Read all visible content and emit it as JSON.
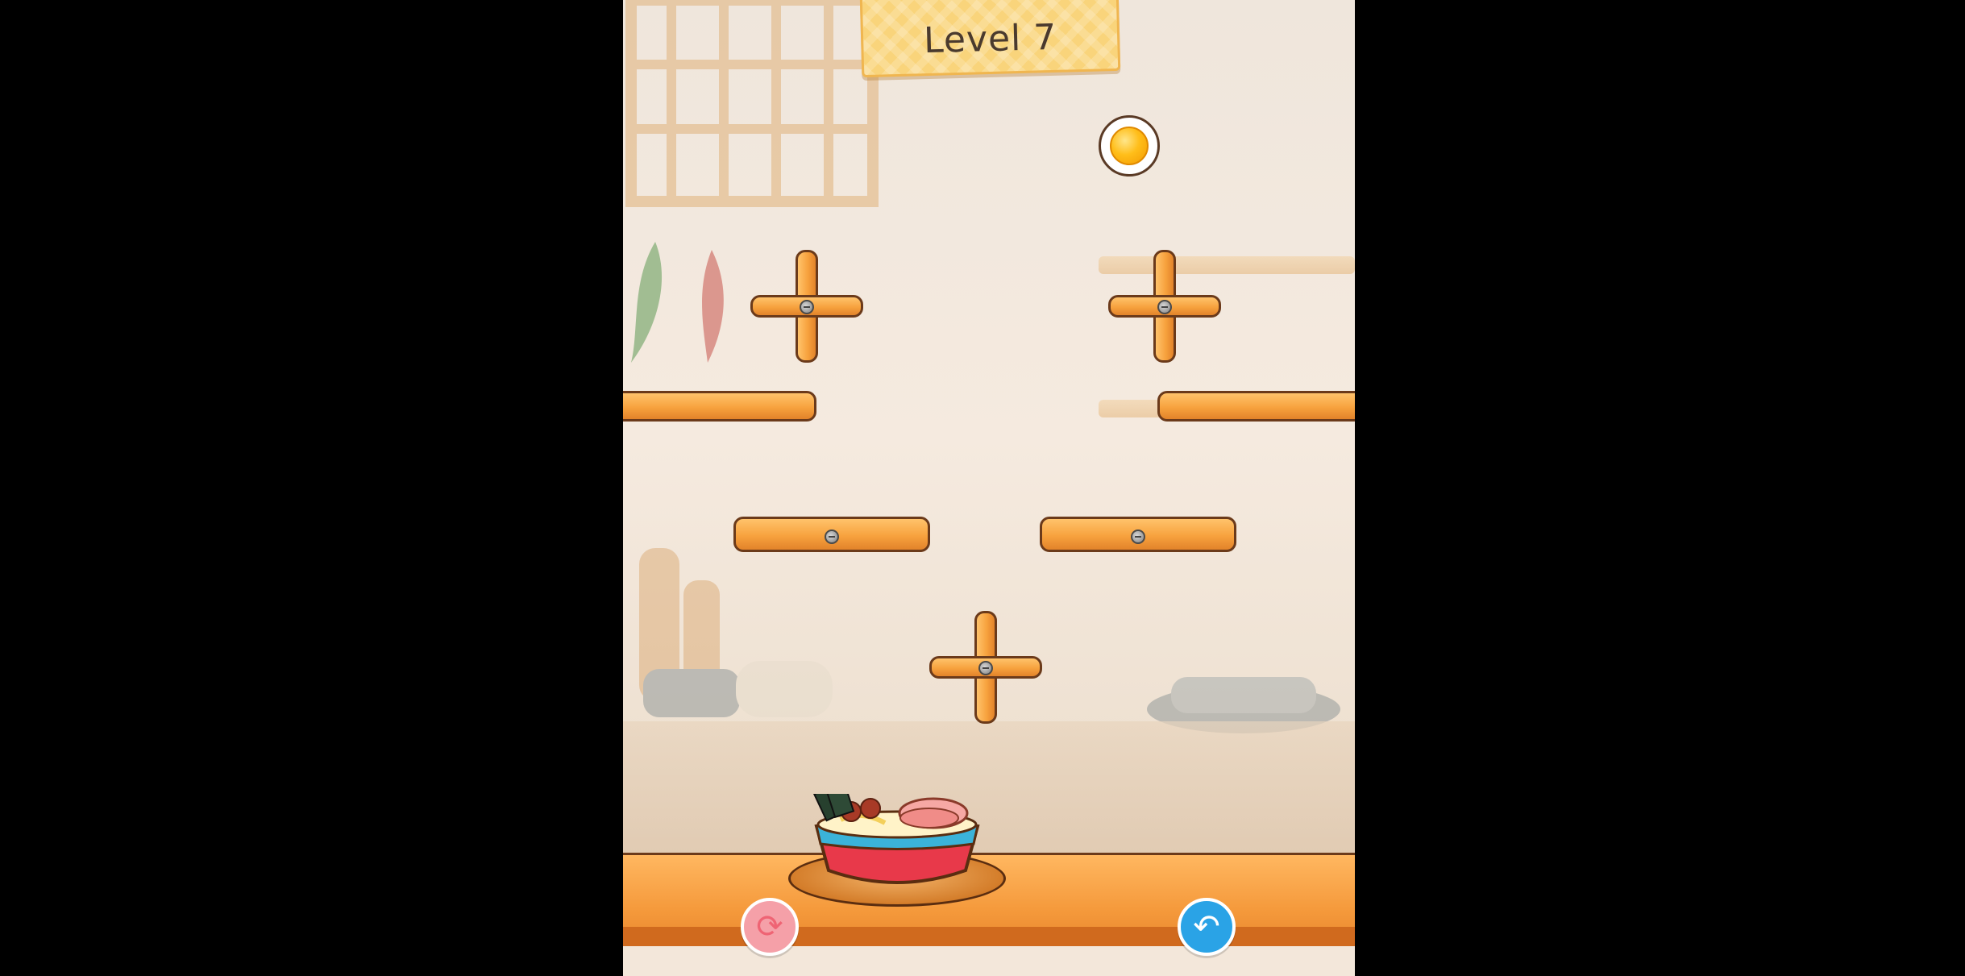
{
  "header": {
    "level_label": "Level 7"
  },
  "controls": {
    "restart_icon": "restart-icon",
    "undo_icon": "undo-icon"
  },
  "colors": {
    "plank": "#f7a23e",
    "plank_outline": "#6b3a1a",
    "banner": "#f9d47b",
    "restart_button": "#f5a0a8",
    "undo_button": "#2aa3e6",
    "table": "#f59a3c"
  }
}
